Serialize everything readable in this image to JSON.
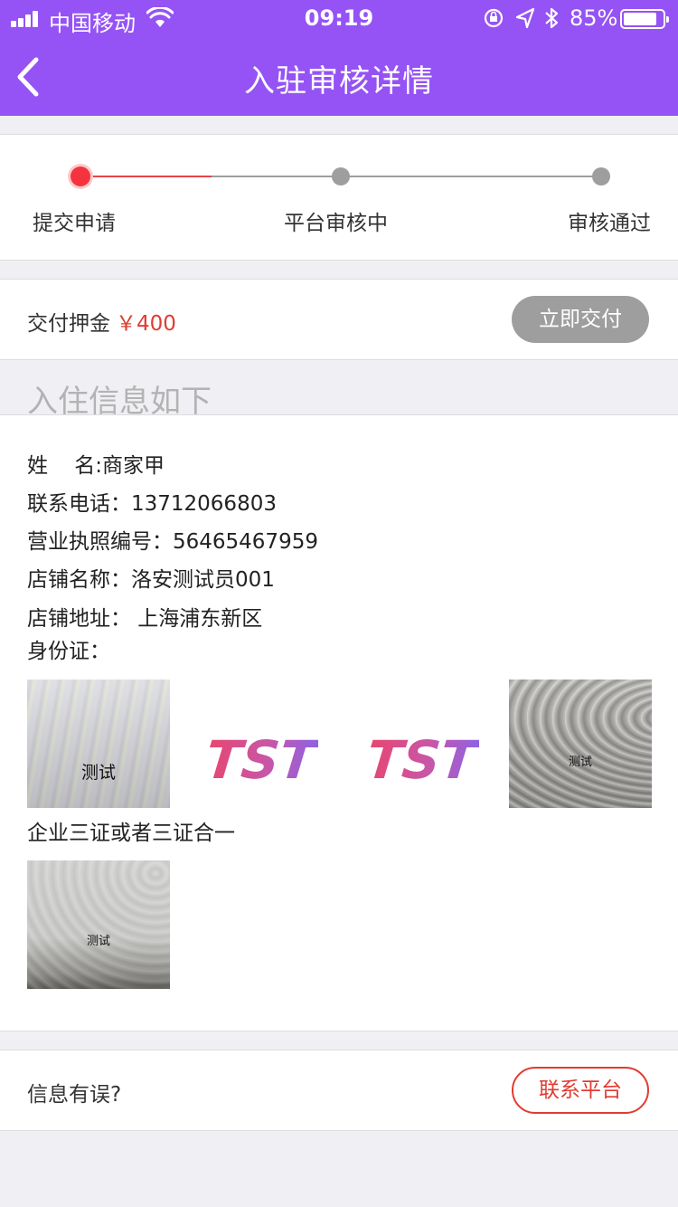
{
  "status_bar": {
    "carrier": "中国移动",
    "time": "09:19",
    "battery": "85%",
    "battery_level": 0.85
  },
  "nav": {
    "title": "入驻审核详情",
    "back_icon": "chevron-left-icon"
  },
  "progress": {
    "current_step": 0,
    "steps": [
      {
        "label": "提交申请"
      },
      {
        "label": "平台审核中"
      },
      {
        "label": "审核通过"
      }
    ],
    "colors": {
      "active": "#f5333e",
      "inactive": "#9e9e9e"
    }
  },
  "deposit": {
    "label": "交付押金",
    "amount": "￥400",
    "button": "立即交付"
  },
  "section_title": "入住信息如下",
  "info": {
    "name": "姓    名:商家甲",
    "phone": "联系电话：13712066803",
    "license": "营业执照编号：56465467959",
    "shop_name": "店铺名称：洛安测试员001",
    "shop_address": "店铺地址： 上海浦东新区",
    "id_card": "身份证：",
    "id_images": [
      {
        "caption": "测试"
      },
      {
        "logo": "TST"
      },
      {
        "logo": "TST"
      },
      {
        "caption": "测试"
      }
    ],
    "business_cert": "企业三证或者三证合一",
    "cert_images": [
      {
        "caption": "测试"
      }
    ]
  },
  "contact": {
    "label": "信息有误?",
    "button": "联系平台"
  },
  "colors": {
    "brand": "#9553f5",
    "accent_red": "#e03c31"
  }
}
